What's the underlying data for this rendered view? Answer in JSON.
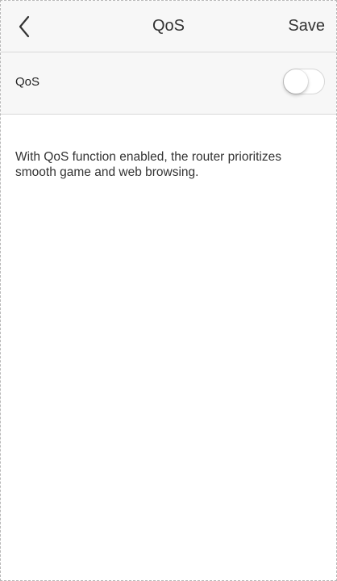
{
  "nav": {
    "back_icon": "chevron-left-icon",
    "title": "QoS",
    "save_label": "Save"
  },
  "settings": {
    "qos_label": "QoS",
    "qos_enabled": false
  },
  "description": "With QoS function enabled, the router prioritizes smooth game and web browsing.",
  "colors": {
    "nav_background": "#f7f7f7",
    "text": "#333333",
    "divider": "#d9d9d9",
    "toggle_off": "#ffffff"
  }
}
